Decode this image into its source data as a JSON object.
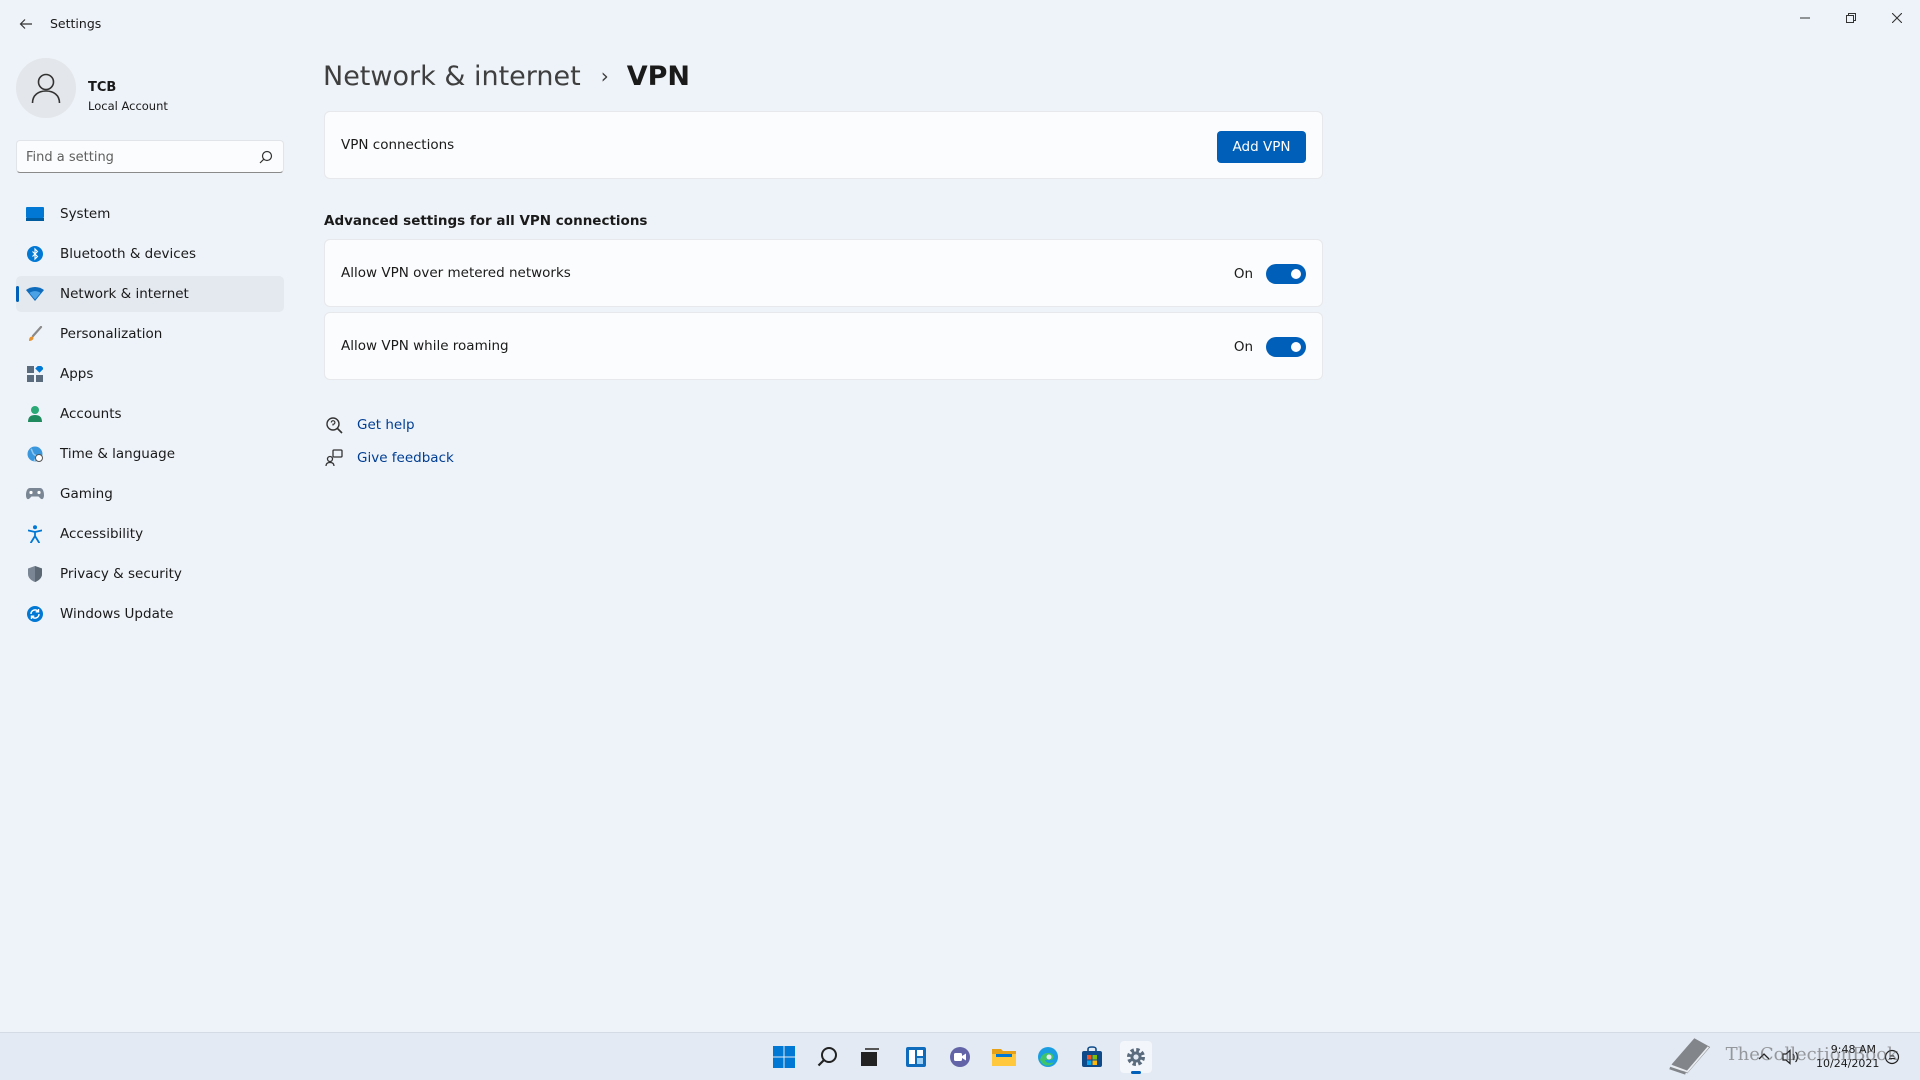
{
  "window": {
    "title": "Settings"
  },
  "profile": {
    "name": "TCB",
    "account_type": "Local Account"
  },
  "search": {
    "placeholder": "Find a setting"
  },
  "sidebar": {
    "items": [
      {
        "label": "System",
        "icon": "system-icon",
        "active": false
      },
      {
        "label": "Bluetooth & devices",
        "icon": "bluetooth-icon",
        "active": false
      },
      {
        "label": "Network & internet",
        "icon": "network-icon",
        "active": true
      },
      {
        "label": "Personalization",
        "icon": "brush-icon",
        "active": false
      },
      {
        "label": "Apps",
        "icon": "apps-icon",
        "active": false
      },
      {
        "label": "Accounts",
        "icon": "accounts-icon",
        "active": false
      },
      {
        "label": "Time & language",
        "icon": "globe-icon",
        "active": false
      },
      {
        "label": "Gaming",
        "icon": "gamepad-icon",
        "active": false
      },
      {
        "label": "Accessibility",
        "icon": "accessibility-icon",
        "active": false
      },
      {
        "label": "Privacy & security",
        "icon": "shield-icon",
        "active": false
      },
      {
        "label": "Windows Update",
        "icon": "update-icon",
        "active": false
      }
    ]
  },
  "breadcrumb": {
    "parent": "Network & internet",
    "separator": "›",
    "current": "VPN"
  },
  "vpn_connections": {
    "label": "VPN connections",
    "add_button": "Add VPN"
  },
  "advanced": {
    "title": "Advanced settings for all VPN connections",
    "settings": [
      {
        "label": "Allow VPN over metered networks",
        "state": "On",
        "enabled": true
      },
      {
        "label": "Allow VPN while roaming",
        "state": "On",
        "enabled": true
      }
    ]
  },
  "links": {
    "help": "Get help",
    "feedback": "Give feedback"
  },
  "taskbar": {
    "apps": [
      "start-icon",
      "search-icon",
      "task-view-icon",
      "widgets-icon",
      "chat-icon",
      "file-explorer-icon",
      "edge-icon",
      "store-icon",
      "settings-icon"
    ],
    "clock_time": "9:48 AM",
    "clock_date": "10/24/2021"
  },
  "watermark": {
    "text": "TheCollectionBook"
  },
  "colors": {
    "accent": "#005fb8",
    "background": "#eef3f9",
    "card": "#fbfcfd",
    "link": "#003e92"
  }
}
